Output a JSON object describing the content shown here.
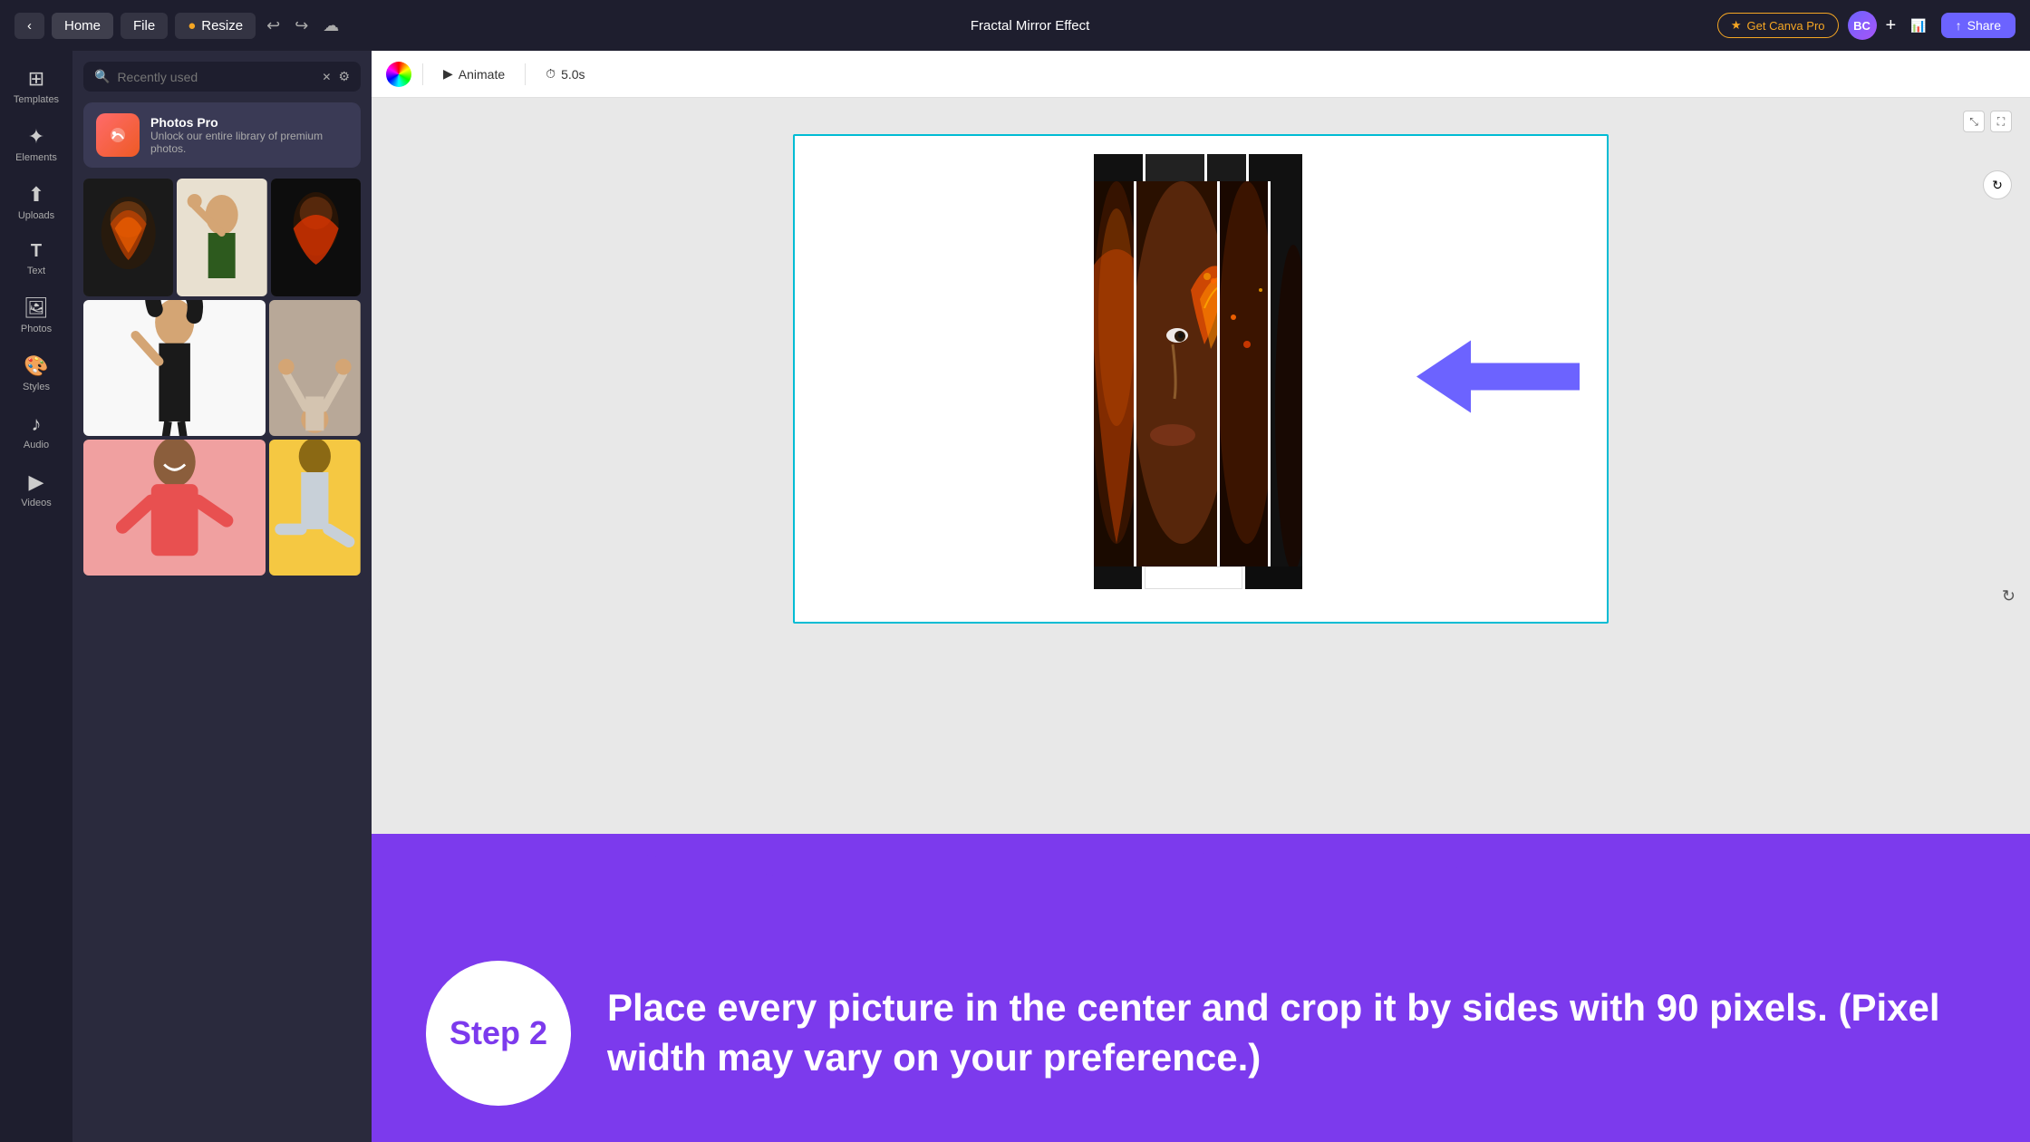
{
  "topbar": {
    "home_label": "Home",
    "file_label": "File",
    "resize_label": "Resize",
    "project_title": "Fractal Mirror Effect",
    "get_pro_label": "Get Canva Pro",
    "share_label": "Share",
    "avatar_initials": "BC"
  },
  "sidebar": {
    "items": [
      {
        "id": "templates",
        "label": "Templates",
        "icon": "⊞"
      },
      {
        "id": "elements",
        "label": "Elements",
        "icon": "✦"
      },
      {
        "id": "uploads",
        "label": "Uploads",
        "icon": "⬆"
      },
      {
        "id": "text",
        "label": "Text",
        "icon": "T"
      },
      {
        "id": "photos",
        "label": "Photos",
        "icon": "🖼"
      },
      {
        "id": "styles",
        "label": "Styles",
        "icon": "🎨"
      },
      {
        "id": "audio",
        "label": "Audio",
        "icon": "♪"
      },
      {
        "id": "videos",
        "label": "Videos",
        "icon": "▶"
      }
    ]
  },
  "panel": {
    "search_placeholder": "Recently used",
    "photos_pro": {
      "title": "Photos Pro",
      "subtitle": "Unlock our entire library of premium photos."
    }
  },
  "toolbar": {
    "animate_label": "Animate",
    "duration_label": "5.0s"
  },
  "bottom": {
    "step_number": "Step 2",
    "description": "Place every picture in the center and crop it by sides with 90 pixels. (Pixel width may vary on your preference.)"
  },
  "colors": {
    "purple": "#7c3aed",
    "teal": "#00bcd4",
    "arrow_purple": "#6c63ff"
  }
}
